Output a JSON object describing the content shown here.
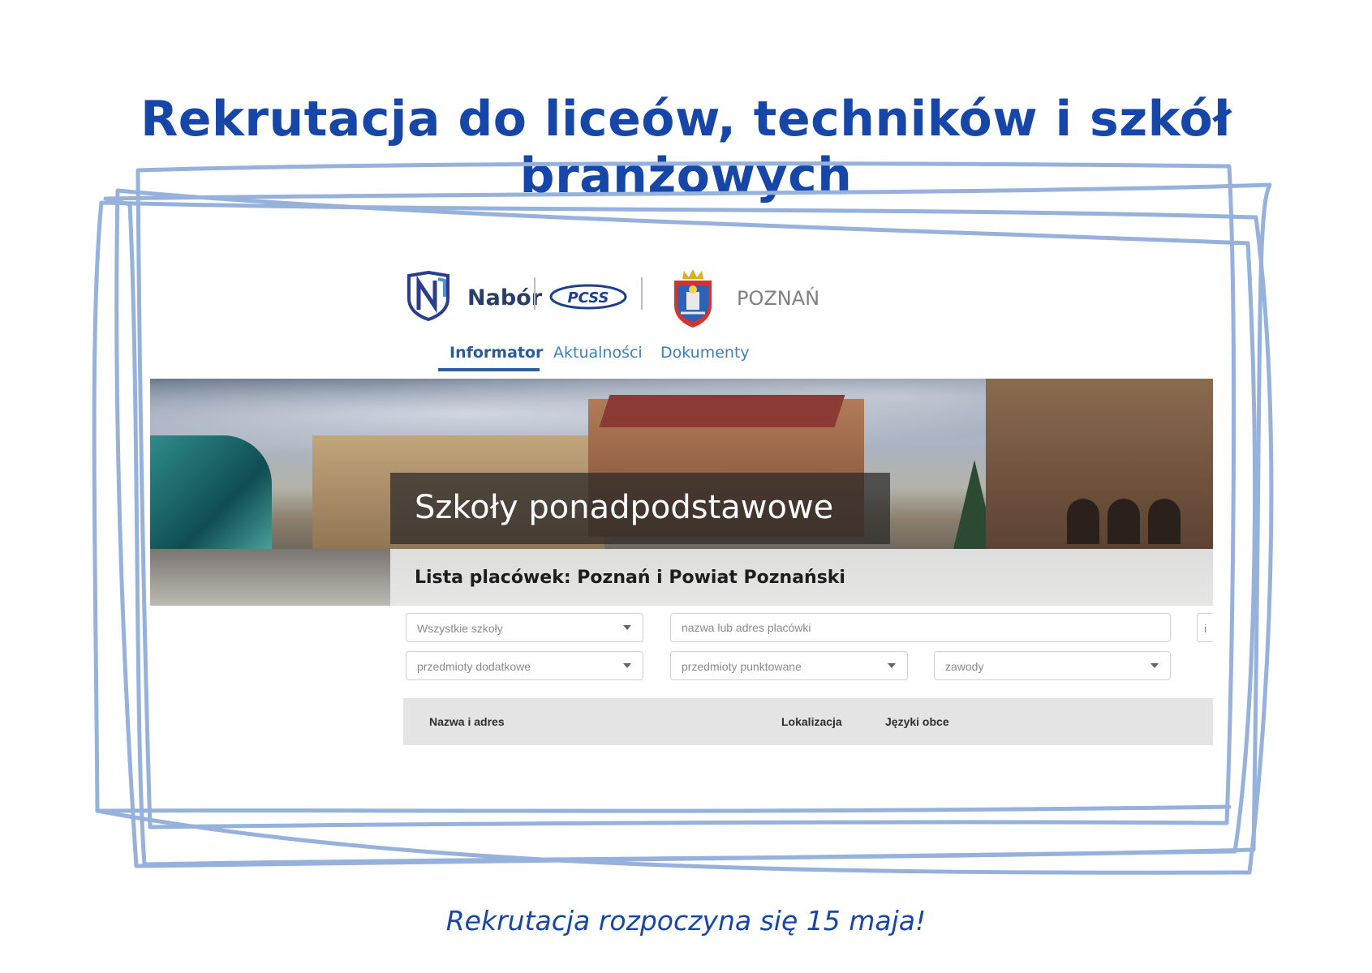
{
  "headline": "Rekrutacja do liceów, techników i szkół branżowych",
  "footer": "Rekrutacja rozpoczyna się 15  maja!",
  "colors": {
    "accent": "#1546a8",
    "frame": "#95b1dc"
  },
  "screenshot": {
    "header": {
      "brand": "Nabór",
      "pcss_logo_text": "PCSS",
      "city": "POZNAŃ",
      "icons": [
        "nabor-logo-icon",
        "pcss-logo-icon",
        "poznan-crest-icon"
      ]
    },
    "nav": {
      "items": [
        {
          "label": "Informator",
          "active": true
        },
        {
          "label": "Aktualności",
          "active": false
        },
        {
          "label": "Dokumenty",
          "active": false
        }
      ]
    },
    "banner": {
      "title": "Szkoły ponadpodstawowe",
      "subtitle": "Lista placówek: Poznań i Powiat Poznański"
    },
    "filters": {
      "school_type": "Wszystkie szkoły",
      "search_placeholder": "nazwa lub adres placówki",
      "extra_subjects": "przedmioty dodatkowe",
      "scored_subjects": "przedmioty punktowane",
      "professions": "zawody",
      "cut_field_text": "i"
    },
    "table": {
      "columns": [
        "Nazwa i adres",
        "Lokalizacja",
        "Języki obce"
      ]
    }
  }
}
